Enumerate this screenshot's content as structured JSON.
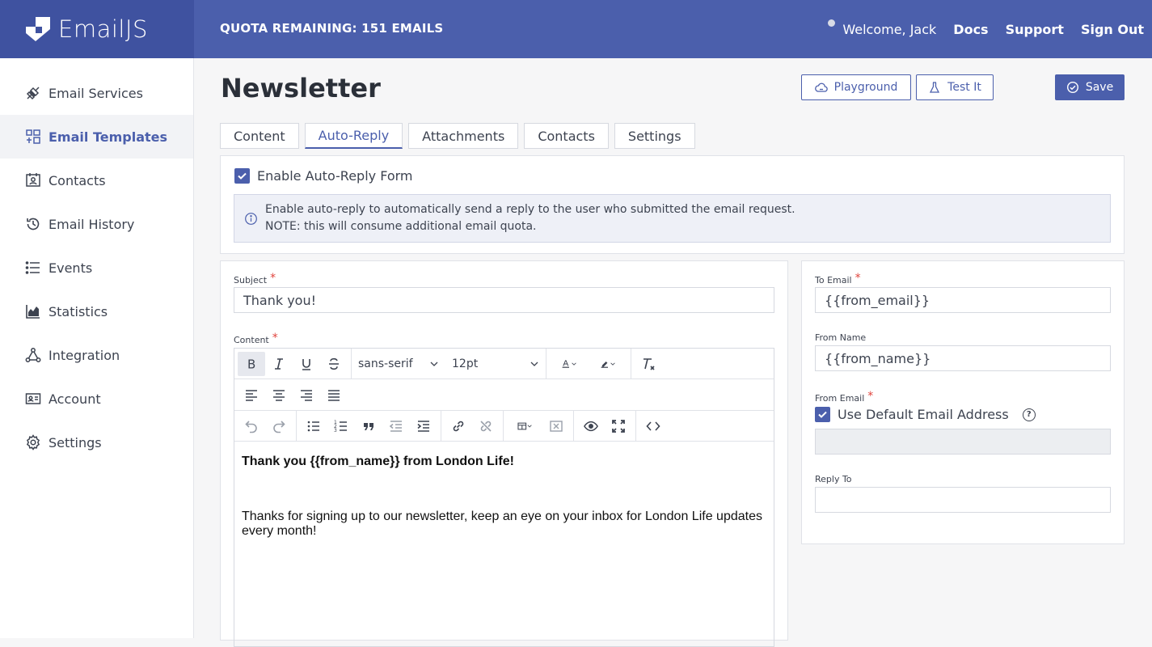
{
  "app": {
    "brand": "EmailJS"
  },
  "header": {
    "quota": "QUOTA REMAINING: 151 EMAILS",
    "welcome": "Welcome,  Jack",
    "docs": "Docs",
    "support": "Support",
    "sign_out": "Sign Out"
  },
  "sidebar": {
    "items": [
      {
        "label": "Email Services",
        "icon": "plug-icon"
      },
      {
        "label": "Email Templates",
        "icon": "template-icon"
      },
      {
        "label": "Contacts",
        "icon": "contacts-icon"
      },
      {
        "label": "Email History",
        "icon": "history-icon"
      },
      {
        "label": "Events",
        "icon": "list-icon"
      },
      {
        "label": "Statistics",
        "icon": "chart-icon"
      },
      {
        "label": "Integration",
        "icon": "integration-icon"
      },
      {
        "label": "Account",
        "icon": "account-icon"
      },
      {
        "label": "Settings",
        "icon": "gear-icon"
      }
    ],
    "active": "Email Templates"
  },
  "page": {
    "title": "Newsletter",
    "playground": "Playground",
    "test_it": "Test It",
    "save": "Save"
  },
  "tabs": [
    "Content",
    "Auto-Reply",
    "Attachments",
    "Contacts",
    "Settings"
  ],
  "active_tab": "Auto-Reply",
  "autoreply": {
    "enable_label": "Enable Auto-Reply Form",
    "enabled": true,
    "info_line1": "Enable auto-reply to automatically send a reply to the user who submitted the email request.",
    "info_line2": "NOTE: this will consume additional email quota."
  },
  "form": {
    "subject_label": "Subject",
    "subject_value": "Thank you!",
    "content_label": "Content",
    "font_family": "sans-serif",
    "font_size": "12pt",
    "content_heading": "Thank you {{from_name}} from London Life!",
    "content_body": "Thanks for signing up to our newsletter, keep an eye on your inbox for London Life updates every month!",
    "to_email_label": "To Email",
    "to_email_value": "{{from_email}}",
    "from_name_label": "From Name",
    "from_name_value": "{{from_name}}",
    "from_email_label": "From Email",
    "use_default_label": "Use Default Email Address",
    "use_default_checked": true,
    "reply_to_label": "Reply To",
    "reply_to_value": ""
  },
  "colors": {
    "brand": "#4b5fac",
    "brand_dark": "#3f52a0",
    "required": "#e0443d"
  }
}
